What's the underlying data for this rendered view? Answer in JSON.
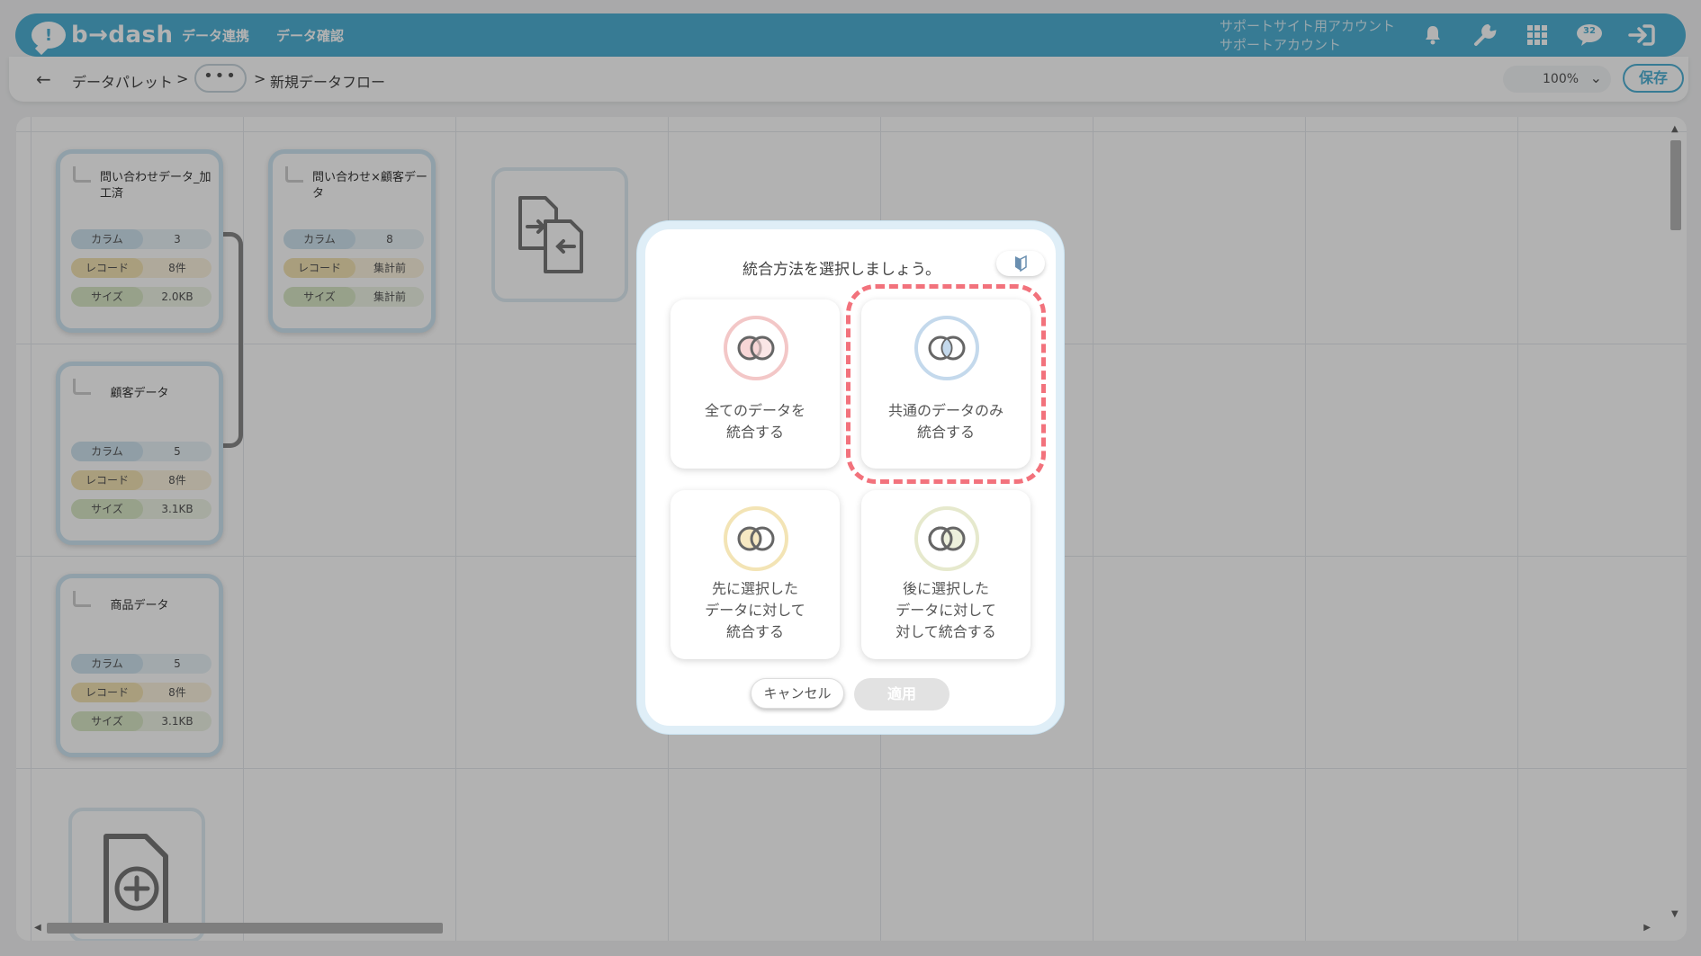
{
  "app": {
    "logo_text": "b→dash"
  },
  "nav": [
    "データ連携",
    "データ確認"
  ],
  "account": {
    "line1": "サポートサイト用アカウント",
    "line2": "サポートアカウント",
    "badge": "32"
  },
  "header_icons": [
    "bell-icon",
    "wrench-icon",
    "grid-icon",
    "notification-bubble-icon",
    "logout-icon"
  ],
  "breadcrumb": {
    "back": "←",
    "item1": "データパレット",
    "sep": ">",
    "more": "•••",
    "current": "新規データフロー"
  },
  "toolbar": {
    "zoom": "100%",
    "zoom_caret": "⌄",
    "save": "保存"
  },
  "nodes": [
    {
      "title": "問い合わせデータ_加工済",
      "rows": [
        {
          "k": "カラム",
          "v": "3"
        },
        {
          "k": "レコード",
          "v": "8件"
        },
        {
          "k": "サイズ",
          "v": "2.0KB"
        }
      ]
    },
    {
      "title": "問い合わせ×顧客データ",
      "rows": [
        {
          "k": "カラム",
          "v": "8"
        },
        {
          "k": "レコード",
          "v": "集計前"
        },
        {
          "k": "サイズ",
          "v": "集計前"
        }
      ]
    },
    {
      "title": "顧客データ",
      "rows": [
        {
          "k": "カラム",
          "v": "5"
        },
        {
          "k": "レコード",
          "v": "8件"
        },
        {
          "k": "サイズ",
          "v": "3.1KB"
        }
      ]
    },
    {
      "title": "商品データ",
      "rows": [
        {
          "k": "カラム",
          "v": "5"
        },
        {
          "k": "レコード",
          "v": "8件"
        },
        {
          "k": "サイズ",
          "v": "3.1KB"
        }
      ]
    }
  ],
  "modal": {
    "title": "統合方法を選択しましょう。",
    "options": [
      {
        "label1": "全てのデータを",
        "label2": "統合する",
        "color": "#f3c7c7"
      },
      {
        "label1": "共通のデータのみ",
        "label2": "統合する",
        "color": "#c4d9ec",
        "selected": true
      },
      {
        "label1": "先に選択した",
        "label2": "データに対して",
        "label3": "統合する",
        "color": "#f3e4b5"
      },
      {
        "label1": "後に選択した",
        "label2": "データに対して",
        "label3": "対して統合する",
        "color": "#e6e9cd"
      }
    ],
    "cancel": "キャンセル",
    "apply": "適用"
  },
  "colors": {
    "brand": "#4fb0d4",
    "highlight": "#f2727c"
  }
}
